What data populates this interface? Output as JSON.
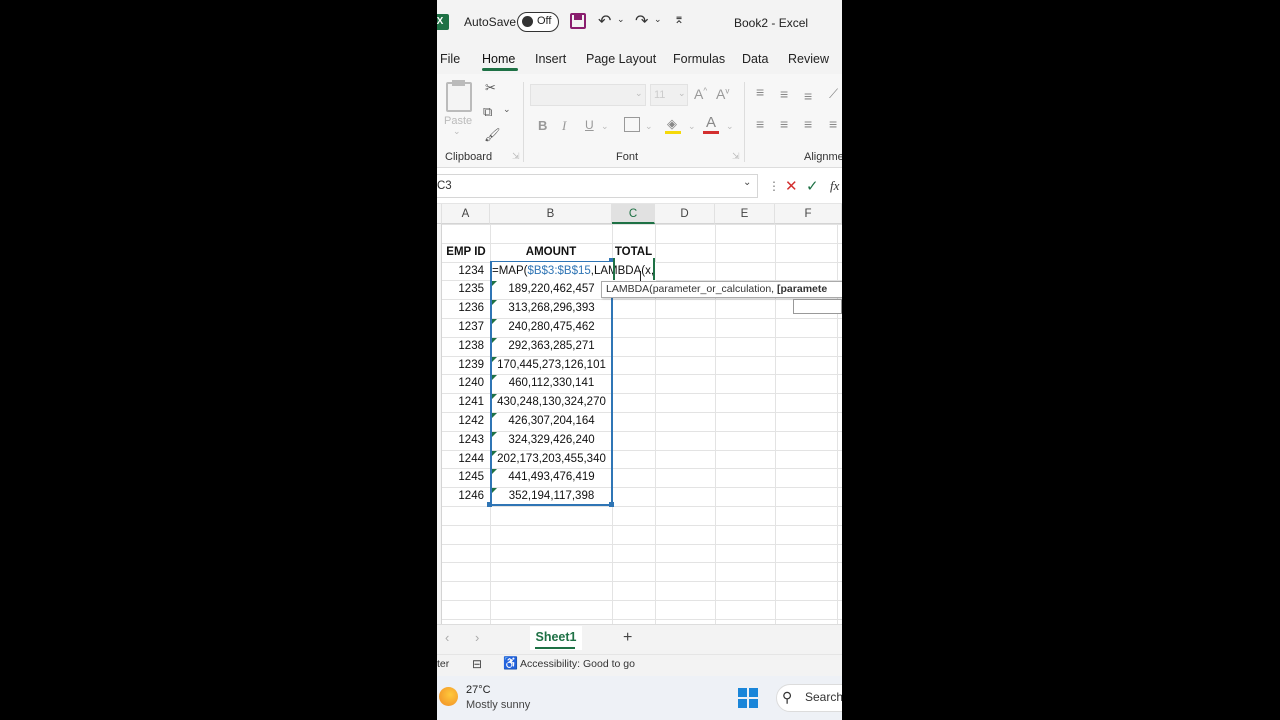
{
  "titlebar": {
    "app_badge": "X",
    "autosave_label": "AutoSave",
    "toggle_state": "Off",
    "title": "Book2 - Excel"
  },
  "menu": [
    "File",
    "Home",
    "Insert",
    "Page Layout",
    "Formulas",
    "Data",
    "Review"
  ],
  "ribbon": {
    "paste_label": "Paste",
    "font_size": "11",
    "groups": {
      "clipboard": "Clipboard",
      "font": "Font",
      "alignment": "Alignme"
    }
  },
  "formula_bar": {
    "name_box": "C3",
    "fx": "fx"
  },
  "columns": [
    "A",
    "B",
    "C",
    "D",
    "E",
    "F"
  ],
  "headers": {
    "a": "EMP ID",
    "b": "AMOUNT",
    "c": "TOTAL"
  },
  "editing": {
    "prefix": "=MAP(",
    "range": "$B$3:$B$15",
    "suffix": ",LAMBDA(x,",
    "tooltip_fn": "LAMBDA(",
    "tooltip_args": "parameter_or_calculation, ",
    "tooltip_bold": "[paramete"
  },
  "rows": [
    {
      "id": "1234",
      "amount": ""
    },
    {
      "id": "1235",
      "amount": "189,220,462,457"
    },
    {
      "id": "1236",
      "amount": "313,268,296,393"
    },
    {
      "id": "1237",
      "amount": "240,280,475,462"
    },
    {
      "id": "1238",
      "amount": "292,363,285,271"
    },
    {
      "id": "1239",
      "amount": "170,445,273,126,101"
    },
    {
      "id": "1240",
      "amount": "460,112,330,141"
    },
    {
      "id": "1241",
      "amount": "430,248,130,324,270"
    },
    {
      "id": "1242",
      "amount": "426,307,204,164"
    },
    {
      "id": "1243",
      "amount": "324,329,426,240"
    },
    {
      "id": "1244",
      "amount": "202,173,203,455,340"
    },
    {
      "id": "1245",
      "amount": "441,493,476,419"
    },
    {
      "id": "1246",
      "amount": "352,194,117,398"
    }
  ],
  "sheet_tab": "Sheet1",
  "add_sheet": "+",
  "status": {
    "left_text": "ter",
    "accessibility": "Accessibility: Good to go"
  },
  "taskbar": {
    "temp": "27°C",
    "weather": "Mostly sunny",
    "search": "Search"
  },
  "colors": {
    "excel_green": "#1e7145",
    "range_blue": "#2f75b5",
    "save_purple": "#8a1e6e"
  }
}
